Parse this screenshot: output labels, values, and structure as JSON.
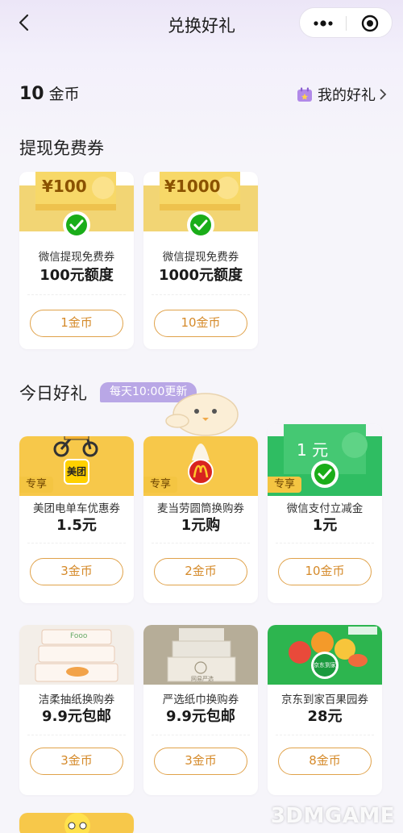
{
  "nav": {
    "title": "兑换好礼"
  },
  "coins": {
    "amount": "10",
    "unit": "金币"
  },
  "mygift": {
    "label": "我的好礼"
  },
  "sections": {
    "withdraw": "提现免费券",
    "daily": "今日好礼",
    "daily_badge": "每天10:00更新"
  },
  "withdraw_cards": [
    {
      "ticket": "¥100",
      "name": "微信提现免费券",
      "value": "100元额度",
      "cost": "1金币"
    },
    {
      "ticket": "¥1000",
      "name": "微信提现免费券",
      "value": "1000元额度",
      "cost": "10金币"
    }
  ],
  "daily_cards": [
    {
      "tag": "专享",
      "brand": "美团",
      "name": "美团电单车优惠券",
      "value": "1.5元",
      "cost": "3金币"
    },
    {
      "tag": "专享",
      "name": "麦当劳圆筒换购券",
      "value": "1元购",
      "cost": "2金币"
    },
    {
      "tag": "专享",
      "ticket": "1 元",
      "name": "微信支付立减金",
      "value": "1元",
      "cost": "10金币"
    },
    {
      "brand_text": "Fooo",
      "name": "洁柔抽纸换购券",
      "value": "9.9元包邮",
      "cost": "3金币"
    },
    {
      "brand_text": "网易严选",
      "name": "严选纸巾换购券",
      "value": "9.9元包邮",
      "cost": "3金币"
    },
    {
      "brand_text": "京东到家",
      "name": "京东到家百果园券",
      "value": "28元",
      "cost": "8金币"
    }
  ],
  "watermark": "3DMGAME",
  "colors": {
    "gold": "#f4c542",
    "wechat_green": "#1aad19",
    "coin_btn": "#e0a24a",
    "badge": "#b9a7e6"
  }
}
